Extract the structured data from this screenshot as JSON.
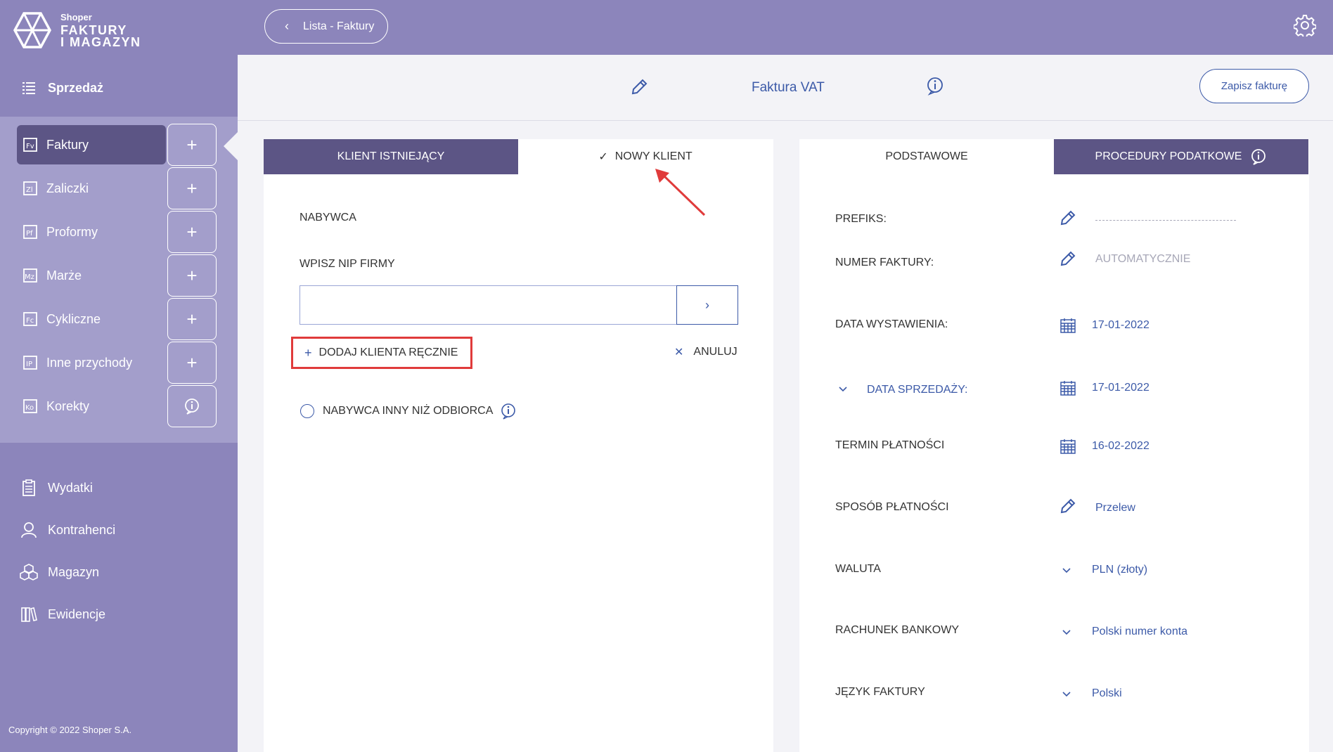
{
  "app": {
    "brand_small": "Shoper",
    "brand_line1": "FAKTURY",
    "brand_line2": "I MAGAZYN",
    "copyright": "Copyright © 2022 Shoper S.A."
  },
  "sidebar": {
    "section": "Sprzedaż",
    "items": [
      {
        "label": "Faktury",
        "active": true,
        "action": "+"
      },
      {
        "label": "Zaliczki",
        "action": "+"
      },
      {
        "label": "Proformy",
        "action": "+"
      },
      {
        "label": "Marże",
        "action": "+"
      },
      {
        "label": "Cykliczne",
        "action": "+"
      },
      {
        "label": "Inne przychody",
        "action": "+"
      },
      {
        "label": "Korekty",
        "action": "info"
      }
    ],
    "lower": [
      {
        "label": "Wydatki"
      },
      {
        "label": "Kontrahenci"
      },
      {
        "label": "Magazyn"
      },
      {
        "label": "Ewidencje"
      }
    ]
  },
  "topbar": {
    "back_label": "Lista - Faktury"
  },
  "header": {
    "title": "Faktura VAT",
    "save_label": "Zapisz fakturę"
  },
  "client": {
    "tab_existing": "KLIENT ISTNIEJĄCY",
    "tab_new": "NOWY KLIENT",
    "buyer_label": "NABYWCA",
    "nip_label": "WPISZ NIP FIRMY",
    "nip_value": "",
    "add_manual": "DODAJ KLIENTA RĘCZNIE",
    "cancel": "ANULUJ",
    "other_recipient": "NABYWCA INNY NIŻ ODBIORCA"
  },
  "details": {
    "tab_basic": "PODSTAWOWE",
    "tab_tax": "PROCEDURY PODATKOWE",
    "fields": {
      "prefix": {
        "label": "PREFIKS:",
        "value": ""
      },
      "number": {
        "label": "NUMER FAKTURY:",
        "value": "AUTOMATYCZNIE"
      },
      "issue_date": {
        "label": "DATA WYSTAWIENIA:",
        "value": "17-01-2022"
      },
      "sale_date": {
        "label": "DATA SPRZEDAŻY:",
        "value": "17-01-2022"
      },
      "due_date": {
        "label": "TERMIN PŁATNOŚCI",
        "value": "16-02-2022"
      },
      "payment": {
        "label": "SPOSÓB PŁATNOŚCI",
        "value": "Przelew"
      },
      "currency": {
        "label": "WALUTA",
        "value": "PLN (złoty)"
      },
      "bank": {
        "label": "RACHUNEK BANKOWY",
        "value": "Polski numer konta"
      },
      "language": {
        "label": "JĘZYK FAKTURY",
        "value": "Polski"
      }
    }
  },
  "colors": {
    "sidebar": "#8c85bb",
    "subpanel": "#a39ecb",
    "active": "#5c5585",
    "accent": "#3c5aa8",
    "highlight": "#e03b3b"
  }
}
